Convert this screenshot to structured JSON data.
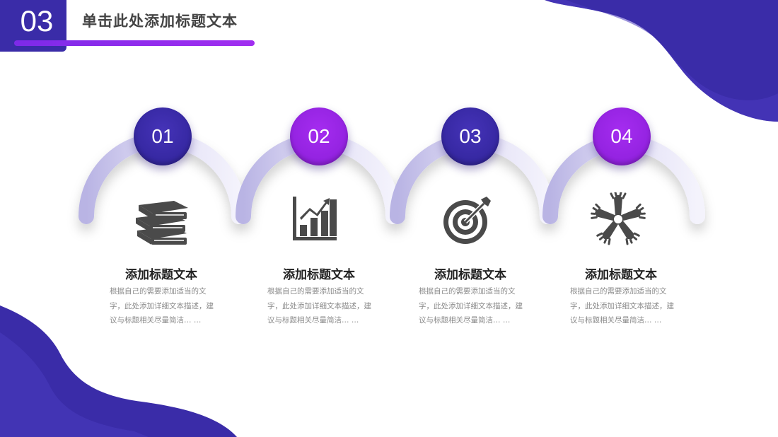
{
  "colors": {
    "primary": "#3a2ca8",
    "accent": "#9b2be6",
    "arc": "#c9c5ec"
  },
  "header": {
    "number": "03",
    "title": "单击此处添加标题文本"
  },
  "steps": [
    {
      "number": "01",
      "icon": "books-icon",
      "badge_color": "blue",
      "title": "添加标题文本",
      "description": "根据自己的需要添加适当的文字，此处添加详细文本描述，建议与标题相关尽量简洁… …"
    },
    {
      "number": "02",
      "icon": "bar-chart-icon",
      "badge_color": "purple",
      "title": "添加标题文本",
      "description": "根据自己的需要添加适当的文字，此处添加详细文本描述，建议与标题相关尽量简洁… …"
    },
    {
      "number": "03",
      "icon": "target-icon",
      "badge_color": "blue",
      "title": "添加标题文本",
      "description": "根据自己的需要添加适当的文字，此处添加详细文本描述，建议与标题相关尽量简洁… …"
    },
    {
      "number": "04",
      "icon": "teamwork-hands-icon",
      "badge_color": "purple",
      "title": "添加标题文本",
      "description": "根据自己的需要添加适当的文字，此处添加详细文本描述，建议与标题相关尽量简洁… …"
    }
  ]
}
